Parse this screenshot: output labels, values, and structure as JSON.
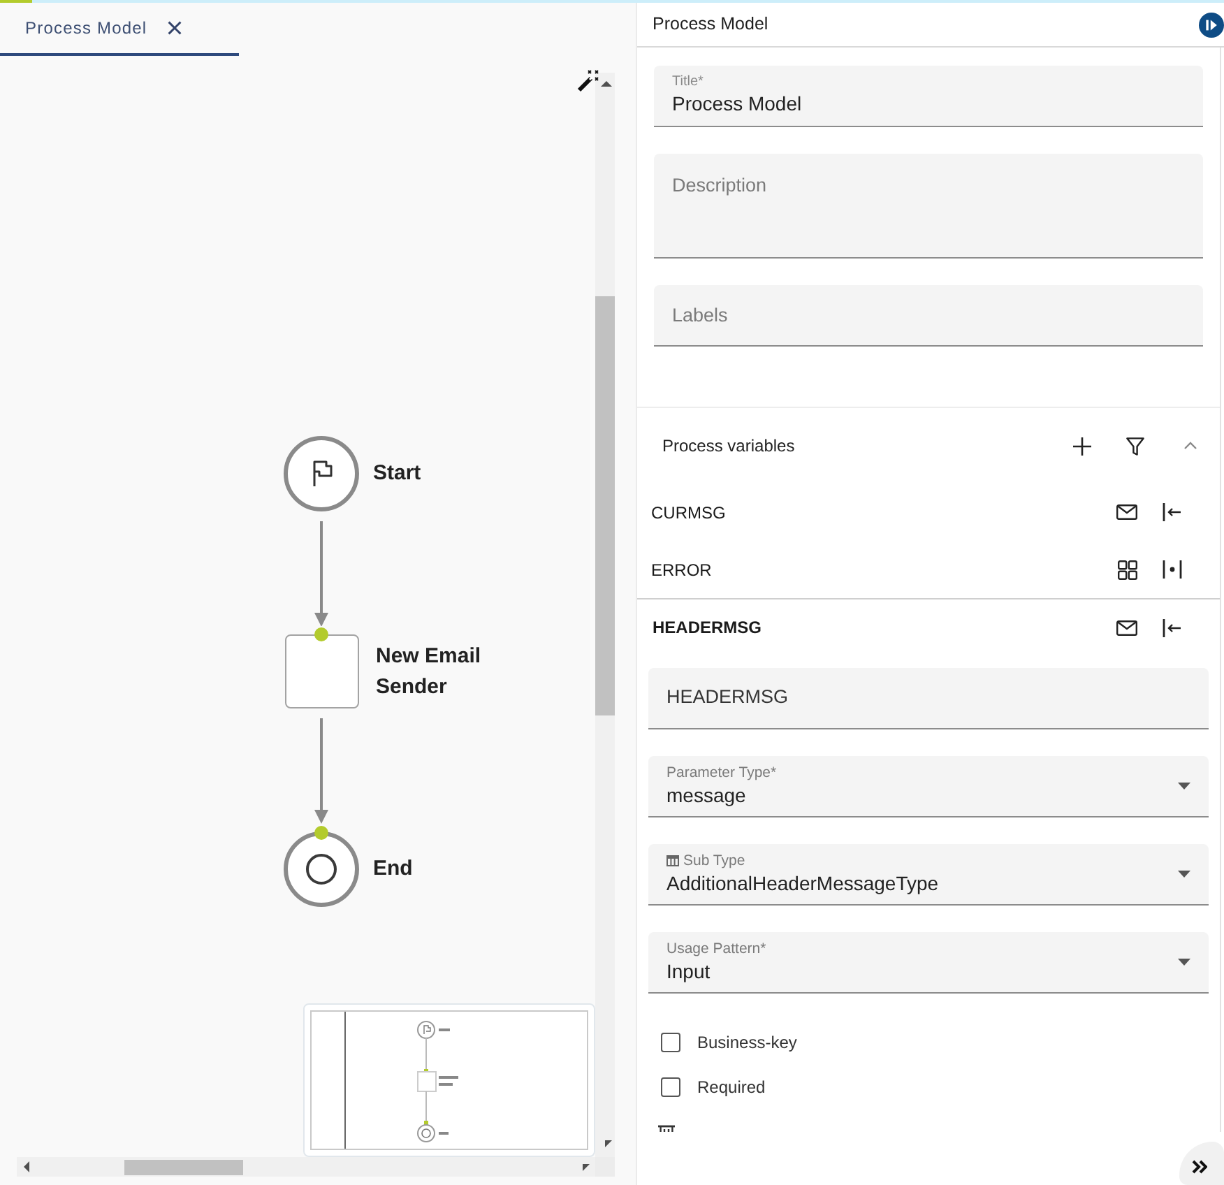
{
  "editor_tabs": [
    {
      "label": "Process Model",
      "selected": true
    }
  ],
  "diagram": {
    "nodes": [
      {
        "kind": "start",
        "label": "Start"
      },
      {
        "kind": "task",
        "label": "New Email Sender"
      },
      {
        "kind": "end",
        "label": "End"
      }
    ]
  },
  "properties_panel": {
    "title": "Process Model",
    "fields": [
      {
        "kind": "input",
        "label": "Title*",
        "value": "Process Model"
      },
      {
        "kind": "textarea",
        "placeholder": "Description"
      },
      {
        "kind": "input",
        "placeholder": "Labels"
      }
    ]
  },
  "process_variables": {
    "title": "Process variables",
    "expanded": true,
    "items": [
      {
        "name": "CURMSG",
        "expanded": false,
        "icons": [
          {
            "kind": "message"
          },
          {
            "kind": "input"
          }
        ]
      },
      {
        "name": "ERROR",
        "expanded": false,
        "icons": [
          {
            "kind": "structure"
          },
          {
            "kind": "local"
          }
        ]
      },
      {
        "name": "HEADERMSG",
        "expanded": true,
        "icons": [
          {
            "kind": "message"
          },
          {
            "kind": "input"
          }
        ],
        "details": {
          "name_value": "HEADERMSG",
          "selects": [
            {
              "kind": "plain",
              "label": "Parameter Type*",
              "value": "message"
            },
            {
              "kind": "typed",
              "label": "Sub Type",
              "value": "AdditionalHeaderMessageType"
            },
            {
              "kind": "plain",
              "label": "Usage Pattern*",
              "value": "Input"
            }
          ],
          "checkboxes": [
            {
              "label": "Business-key",
              "checked": false
            },
            {
              "label": "Required",
              "checked": false
            }
          ]
        }
      }
    ]
  }
}
